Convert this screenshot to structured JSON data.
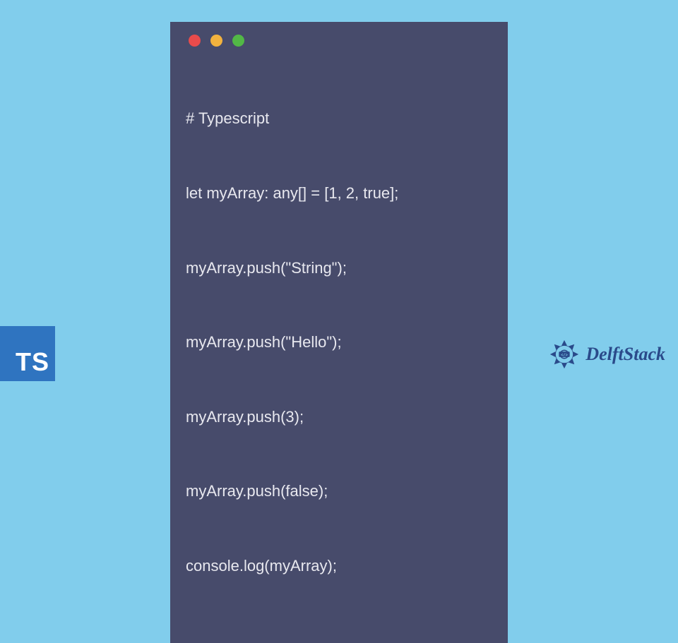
{
  "code": {
    "lines": [
      "# Typescript",
      "let myArray: any[] = [1, 2, true];",
      "myArray.push(\"String\");",
      "myArray.push(\"Hello\");",
      "myArray.push(3);",
      "myArray.push(false);",
      "console.log(myArray);"
    ]
  },
  "ts_badge": "TS",
  "brand": {
    "name": "DelftStack"
  },
  "colors": {
    "background": "#81cdec",
    "window": "#474b6b",
    "ts_badge_bg": "#2f74c0",
    "brand_text": "#2a4a8a"
  }
}
